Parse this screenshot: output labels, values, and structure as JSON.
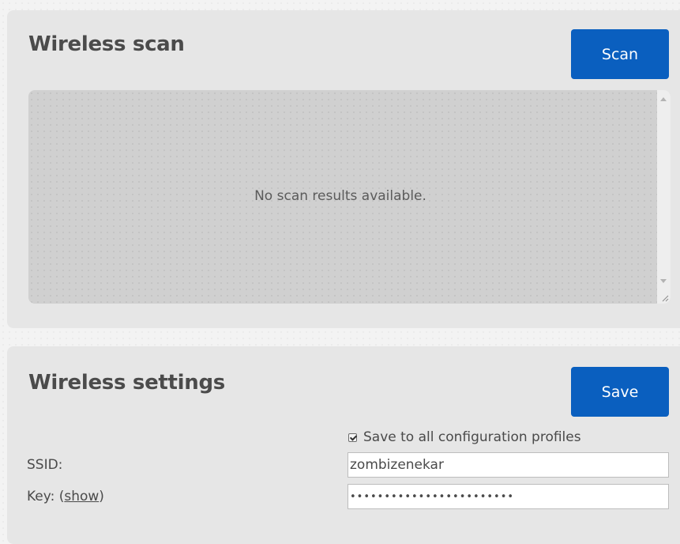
{
  "scan": {
    "title": "Wireless scan",
    "button_label": "Scan",
    "empty_message": "No scan results available."
  },
  "settings": {
    "title": "Wireless settings",
    "button_label": "Save",
    "save_all_profiles": {
      "label": "Save to all configuration profiles",
      "checked": true
    },
    "ssid": {
      "label": "SSID:",
      "value": "zombizenekar"
    },
    "key": {
      "label": "Key:",
      "show_link_label": "show",
      "value": "••••••••••••••••••••••••"
    }
  },
  "colors": {
    "primary_button": "#0a5fbf",
    "panel_background": "#e6e6e6",
    "results_background": "#d0d0d0"
  }
}
